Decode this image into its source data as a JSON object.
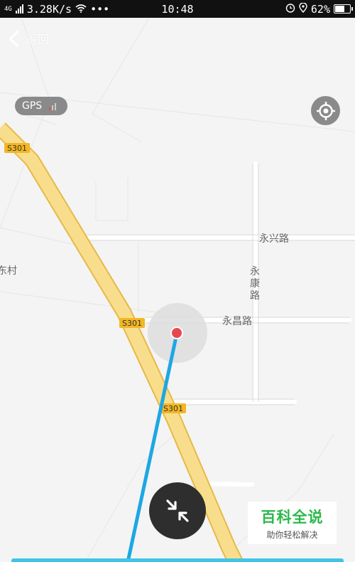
{
  "status_bar": {
    "network": "4G",
    "speed": "3.28K/s",
    "more": "•••",
    "time": "10:48",
    "battery": "62%"
  },
  "nav": {
    "back_label": "返回"
  },
  "gps": {
    "label": "GPS"
  },
  "map": {
    "village_label": "东村",
    "road_labels": {
      "yongxing": "永兴路",
      "yongkang": "永\n康\n路",
      "yongchang": "永昌路"
    },
    "highway_badges": [
      "S301",
      "S301",
      "S301"
    ],
    "colors": {
      "highway_fill": "#f8de8c",
      "highway_edge": "#e7b948",
      "route": "#1ea7e3",
      "marker": "#e9474f",
      "accuracy": "#dddddd"
    }
  },
  "watermark": {
    "title": "百科全说",
    "subtitle": "助你轻松解决"
  }
}
